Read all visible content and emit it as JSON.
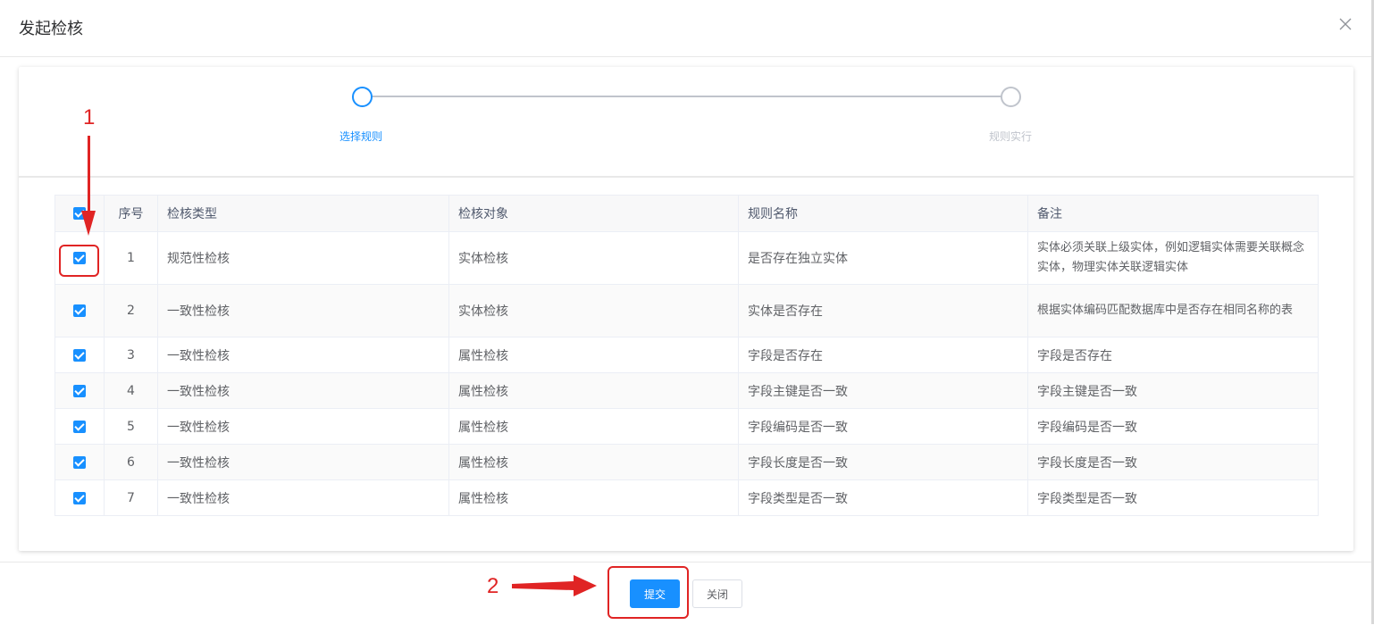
{
  "dialog": {
    "title": "发起检核"
  },
  "steps": [
    {
      "label": "选择规则",
      "state": "active"
    },
    {
      "label": "规则实行",
      "state": "wait"
    }
  ],
  "table": {
    "columns": [
      "序号",
      "检核类型",
      "检核对象",
      "规则名称",
      "备注"
    ],
    "rows": [
      {
        "index": "1",
        "type": "规范性检核",
        "object": "实体检核",
        "rule": "是否存在独立实体",
        "remark": "实体必须关联上级实体，例如逻辑实体需要关联概念实体，物理实体关联逻辑实体",
        "checked": true
      },
      {
        "index": "2",
        "type": "一致性检核",
        "object": "实体检核",
        "rule": "实体是否存在",
        "remark": "根据实体编码匹配数据库中是否存在相同名称的表",
        "checked": true
      },
      {
        "index": "3",
        "type": "一致性检核",
        "object": "属性检核",
        "rule": "字段是否存在",
        "remark": "字段是否存在",
        "checked": true
      },
      {
        "index": "4",
        "type": "一致性检核",
        "object": "属性检核",
        "rule": "字段主键是否一致",
        "remark": "字段主键是否一致",
        "checked": true
      },
      {
        "index": "5",
        "type": "一致性检核",
        "object": "属性检核",
        "rule": "字段编码是否一致",
        "remark": "字段编码是否一致",
        "checked": true
      },
      {
        "index": "6",
        "type": "一致性检核",
        "object": "属性检核",
        "rule": "字段长度是否一致",
        "remark": "字段长度是否一致",
        "checked": true
      },
      {
        "index": "7",
        "type": "一致性检核",
        "object": "属性检核",
        "rule": "字段类型是否一致",
        "remark": "字段类型是否一致",
        "checked": true
      }
    ]
  },
  "footer": {
    "submit_label": "提交",
    "close_label": "关闭"
  },
  "annotations": {
    "step1": "1",
    "step2": "2"
  },
  "colors": {
    "primary": "#1890ff",
    "annotation": "#e02424"
  }
}
